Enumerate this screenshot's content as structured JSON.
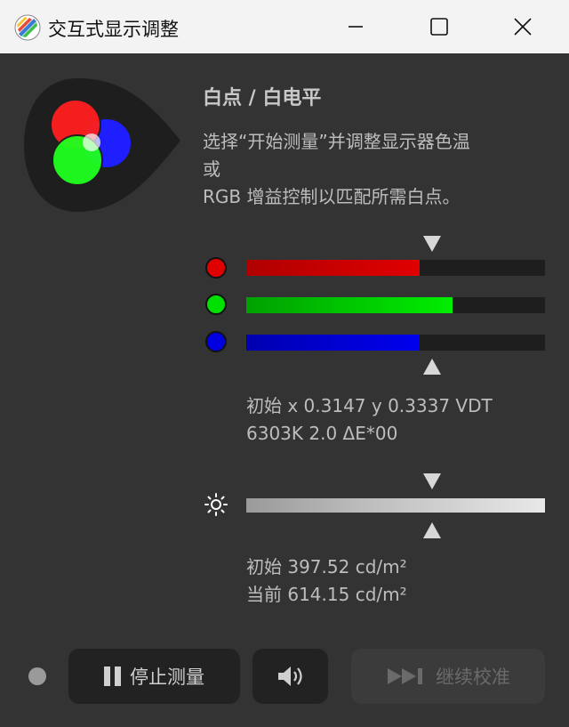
{
  "window": {
    "title": "交互式显示调整"
  },
  "section": {
    "heading": "白点 / 白电平",
    "description_lines": [
      "选择“开始测量”并调整显示器色温",
      "或",
      "RGB 增益控制以匹配所需白点。"
    ]
  },
  "rgb_channels": [
    {
      "name": "red",
      "color": "#e00000",
      "fill_fraction": 0.58
    },
    {
      "name": "green",
      "color": "#00e000",
      "fill_fraction": 0.69
    },
    {
      "name": "blue",
      "color": "#0000e0",
      "fill_fraction": 0.58
    }
  ],
  "white_point": {
    "line1": "初始 x 0.3147 y 0.3337 VDT",
    "line2": "6303K 2.0 ΔE*00"
  },
  "luminance": {
    "initial": "初始 397.52 cd/m²",
    "current": "当前 614.15 cd/m²"
  },
  "buttons": {
    "stop_label": "停止测量",
    "continue_label": "继续校准"
  },
  "icons": {
    "pause": "pause-icon",
    "speaker": "speaker-icon",
    "skip": "skip-forward-icon",
    "brightness": "sun-icon"
  }
}
